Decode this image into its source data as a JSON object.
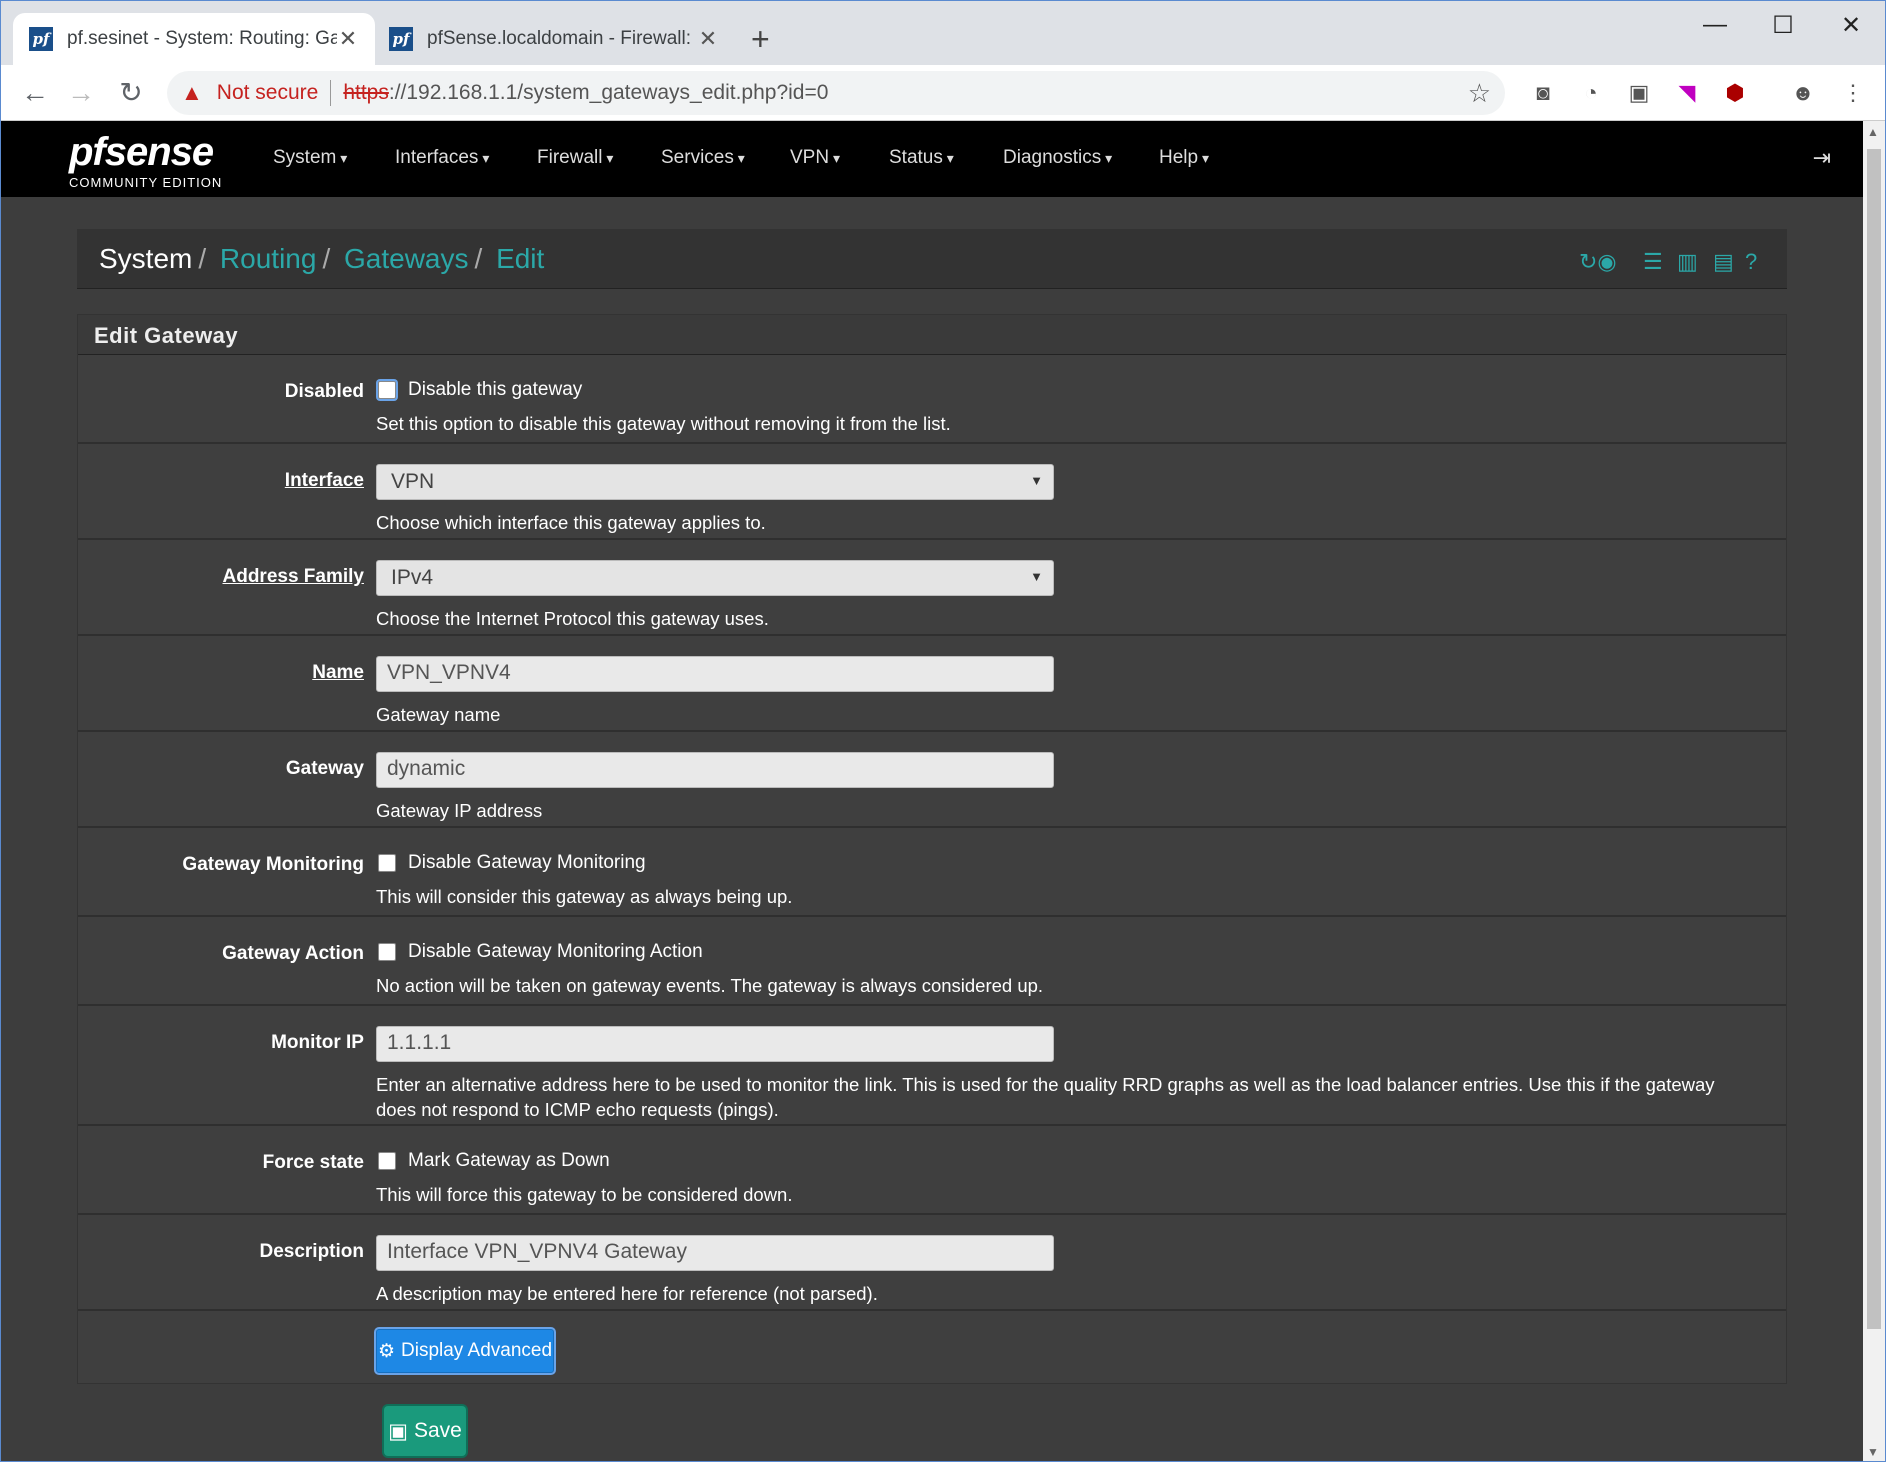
{
  "browser": {
    "tabs": [
      {
        "title": "pf.sesinet - System: Routing: Gate",
        "favicon": "pf"
      },
      {
        "title": "pfSense.localdomain - Firewall: N",
        "favicon": "pf"
      }
    ],
    "address": {
      "warning": "Not secure",
      "scheme": "https",
      "rest": "://192.168.1.1/system_gateways_edit.php?id=0"
    }
  },
  "brand": {
    "logo": "pfsense",
    "edition": "COMMUNITY EDITION"
  },
  "nav": [
    "System",
    "Interfaces",
    "Firewall",
    "Services",
    "VPN",
    "Status",
    "Diagnostics",
    "Help"
  ],
  "breadcrumb": {
    "root": "System",
    "l1": "Routing",
    "l2": "Gateways",
    "l3": "Edit"
  },
  "panel_title": "Edit Gateway",
  "form": {
    "disabled": {
      "label": "Disabled",
      "cb": "Disable this gateway",
      "help": "Set this option to disable this gateway without removing it from the list."
    },
    "interface": {
      "label": "Interface",
      "value": "VPN",
      "help": "Choose which interface this gateway applies to."
    },
    "family": {
      "label": "Address Family",
      "value": "IPv4",
      "help": "Choose the Internet Protocol this gateway uses."
    },
    "name": {
      "label": "Name",
      "value": "VPN_VPNV4",
      "help": "Gateway name"
    },
    "gateway": {
      "label": "Gateway",
      "value": "dynamic",
      "help": "Gateway IP address"
    },
    "monitoring": {
      "label": "Gateway Monitoring",
      "cb": "Disable Gateway Monitoring",
      "help": "This will consider this gateway as always being up."
    },
    "action": {
      "label": "Gateway Action",
      "cb": "Disable Gateway Monitoring Action",
      "help": "No action will be taken on gateway events. The gateway is always considered up."
    },
    "monitor_ip": {
      "label": "Monitor IP",
      "value": "1.1.1.1",
      "help": "Enter an alternative address here to be used to monitor the link. This is used for the quality RRD graphs as well as the load balancer entries. Use this if the gateway does not respond to ICMP echo requests (pings)."
    },
    "force": {
      "label": "Force state",
      "cb": "Mark Gateway as Down",
      "help": "This will force this gateway to be considered down."
    },
    "description": {
      "label": "Description",
      "value": "Interface VPN_VPNV4 Gateway",
      "help": "A description may be entered here for reference (not parsed)."
    }
  },
  "buttons": {
    "advanced": "Display Advanced",
    "save": "Save"
  },
  "colors": {
    "accent": "#2ba8a8",
    "primary": "#1e88e5",
    "success": "#1a9a7c"
  }
}
